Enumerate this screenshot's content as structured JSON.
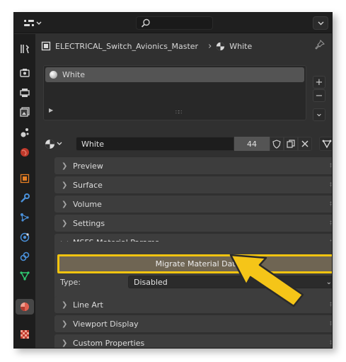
{
  "topbar": {
    "editor_type_icon": "properties-editor-icon",
    "search_icon": "search-icon",
    "options_icon": "chevron-down-icon"
  },
  "tabs": [
    {
      "icon": "tool-icon",
      "active": false
    },
    {
      "icon": "render-icon",
      "active": false
    },
    {
      "icon": "output-icon",
      "active": false
    },
    {
      "icon": "view-layer-icon",
      "active": false
    },
    {
      "icon": "scene-icon",
      "active": false
    },
    {
      "icon": "world-icon",
      "active": false
    },
    {
      "icon": "object-icon",
      "active": false
    },
    {
      "icon": "modifier-icon",
      "active": false
    },
    {
      "icon": "particles-icon",
      "active": false
    },
    {
      "icon": "physics-icon",
      "active": false
    },
    {
      "icon": "constraints-icon",
      "active": false
    },
    {
      "icon": "object-data-icon",
      "active": false
    },
    {
      "icon": "material-icon",
      "active": true
    },
    {
      "icon": "texture-icon",
      "active": false
    }
  ],
  "breadcrumb": {
    "object": "ELECTRICAL_Switch_Avionics_Master",
    "separator": "›",
    "material": "White"
  },
  "material_slots": {
    "items": [
      {
        "name": "White",
        "selected": true
      }
    ],
    "add_label": "+",
    "remove_label": "−",
    "menu_label": "⌄"
  },
  "material_datablock": {
    "name": "White",
    "users": "44"
  },
  "panels_top": [
    {
      "label": "Preview",
      "expanded": false
    },
    {
      "label": "Surface",
      "expanded": false
    },
    {
      "label": "Volume",
      "expanded": false
    },
    {
      "label": "Settings",
      "expanded": false
    }
  ],
  "msfs_panel": {
    "label": "MSFS Material Params",
    "expanded": true,
    "migrate_button": "Migrate Material Data",
    "type_label": "Type:",
    "type_value": "Disabled"
  },
  "panels_bottom": [
    {
      "label": "Line Art",
      "expanded": false
    },
    {
      "label": "Viewport Display",
      "expanded": false
    },
    {
      "label": "Custom Properties",
      "expanded": false
    }
  ],
  "colors": {
    "highlight": "#f1c40f",
    "arrow_fill": "#f5c518",
    "panel_bg": "#3d3d3d",
    "editor_bg": "#303030"
  }
}
